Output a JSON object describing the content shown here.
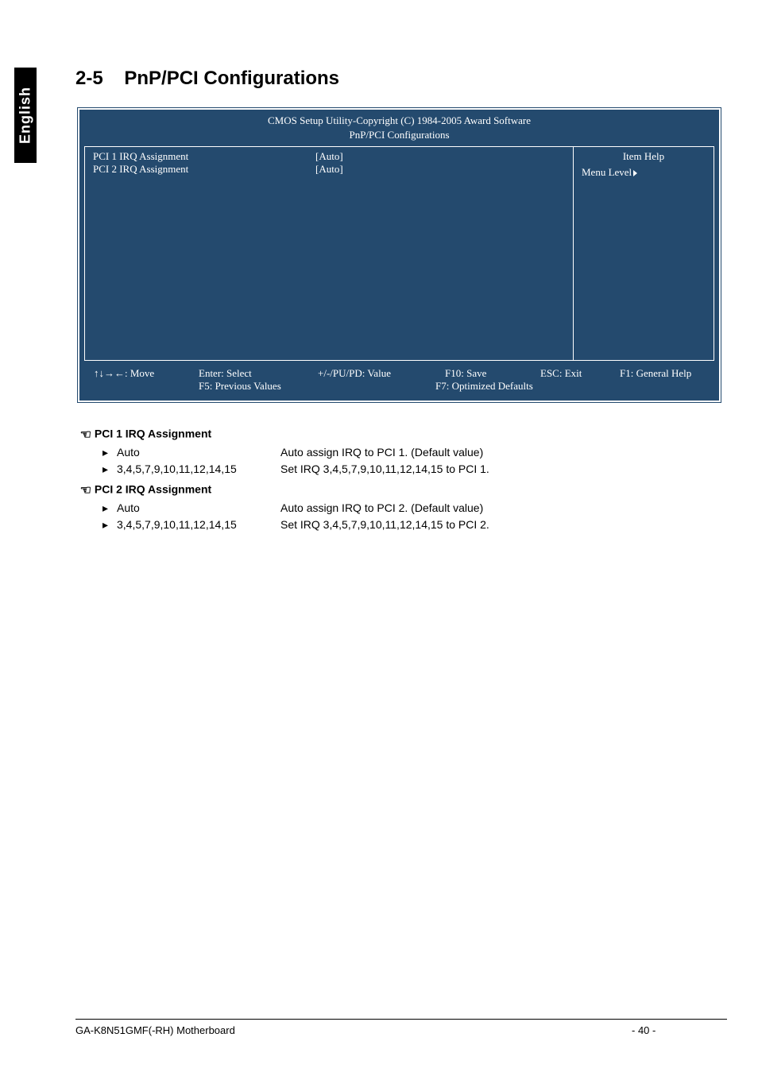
{
  "sideTab": "English",
  "sectionNumber": "2-5",
  "sectionTitle": "PnP/PCI Configurations",
  "bios": {
    "headerLine1": "CMOS Setup Utility-Copyright (C) 1984-2005 Award Software",
    "headerLine2": "PnP/PCI Configurations",
    "rows": [
      {
        "label": "PCI 1 IRQ Assignment",
        "value": "[Auto]"
      },
      {
        "label": "PCI 2 IRQ Assignment",
        "value": "[Auto]"
      }
    ],
    "helpTitle": "Item Help",
    "menuLevel": "Menu Level",
    "footer": {
      "move": "↑↓→←: Move",
      "select": "Enter: Select",
      "value": "+/-/PU/PD: Value",
      "save": "F10: Save",
      "exit": "ESC: Exit",
      "help": "F1: General Help",
      "prev": "F5: Previous Values",
      "opt": "F7: Optimized Defaults"
    }
  },
  "options": [
    {
      "title": "PCI 1 IRQ Assignment",
      "lines": [
        {
          "key": "Auto",
          "desc": "Auto assign IRQ to PCI 1. (Default value)"
        },
        {
          "key": "3,4,5,7,9,10,11,12,14,15",
          "desc": "Set IRQ 3,4,5,7,9,10,11,12,14,15 to PCI 1."
        }
      ]
    },
    {
      "title": "PCI 2 IRQ Assignment",
      "lines": [
        {
          "key": "Auto",
          "desc": "Auto assign IRQ to PCI 2. (Default value)"
        },
        {
          "key": "3,4,5,7,9,10,11,12,14,15",
          "desc": "Set IRQ 3,4,5,7,9,10,11,12,14,15 to PCI 2."
        }
      ]
    }
  ],
  "footerModel": "GA-K8N51GMF(-RH) Motherboard",
  "footerPage": "- 40 -"
}
